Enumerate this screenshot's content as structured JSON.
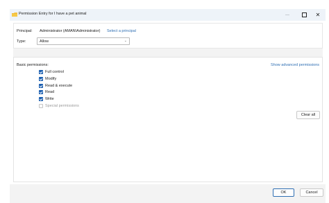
{
  "window": {
    "title": "Permission Entry for I have a pet animal",
    "close_glyph": "✕"
  },
  "principal": {
    "label": "Principal:",
    "value": "Administrator (AMAN\\Administrator)",
    "select_link": "Select a principal"
  },
  "type": {
    "label": "Type:",
    "selected": "Allow"
  },
  "permissions": {
    "heading": "Basic permissions:",
    "advanced_link": "Show advanced permissions",
    "items": [
      {
        "label": "Full control",
        "checked": true,
        "enabled": true
      },
      {
        "label": "Modify",
        "checked": true,
        "enabled": true
      },
      {
        "label": "Read & execute",
        "checked": true,
        "enabled": true
      },
      {
        "label": "Read",
        "checked": true,
        "enabled": true
      },
      {
        "label": "Write",
        "checked": true,
        "enabled": true
      },
      {
        "label": "Special permissions",
        "checked": false,
        "enabled": false
      }
    ],
    "clear_all": "Clear all"
  },
  "footer": {
    "ok": "OK",
    "cancel": "Cancel"
  },
  "colors": {
    "accent": "#1c5fb0",
    "link": "#2f6fb3",
    "folder": "#f0b429"
  }
}
